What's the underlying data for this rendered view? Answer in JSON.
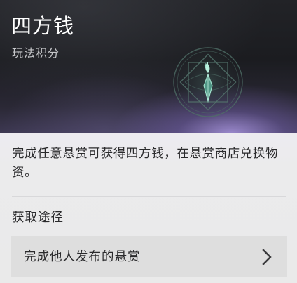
{
  "header": {
    "title": "四方钱",
    "subtitle": "玩法积分",
    "emblem_icon": "currency-emblem-icon"
  },
  "body": {
    "description": "完成任意悬赏可获得四方钱，在悬赏商店兑换物资。",
    "section_heading": "获取途径",
    "sources": [
      {
        "label": "完成他人发布的悬赏",
        "icon": "chevron-right-icon"
      }
    ]
  },
  "colors": {
    "header_dark": "#1b1c20",
    "header_glow": "#aa96e1",
    "panel_bg": "#eaeaea",
    "item_bg": "#dedede",
    "emblem_teal": "#5fa796",
    "text_dark": "#2a2a2c",
    "text_light": "#ffffff"
  }
}
